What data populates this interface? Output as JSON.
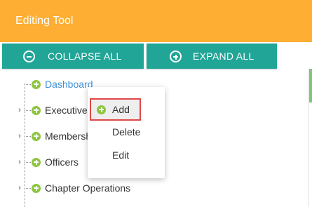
{
  "header": {
    "title": "Editing Tool"
  },
  "toolbar": {
    "collapse_label": "COLLAPSE ALL",
    "expand_label": "EXPAND ALL"
  },
  "tree": {
    "items": [
      {
        "label": "Dashboard",
        "expandable": false
      },
      {
        "label": "Executive",
        "expandable": true
      },
      {
        "label": "Membersh",
        "expandable": true
      },
      {
        "label": "Officers",
        "expandable": true
      },
      {
        "label": "Chapter Operations",
        "expandable": true
      }
    ]
  },
  "context_menu": {
    "add": "Add",
    "delete": "Delete",
    "edit": "Edit"
  },
  "colors": {
    "header": "#FDAE33",
    "button": "#21A596",
    "plus_icon": "#8DC63F",
    "link": "#3b8fd6",
    "highlight_border": "#e04848"
  },
  "icons": [
    "minus-circle-icon",
    "plus-circle-icon",
    "add-node-icon",
    "expand-arrow-icon"
  ]
}
